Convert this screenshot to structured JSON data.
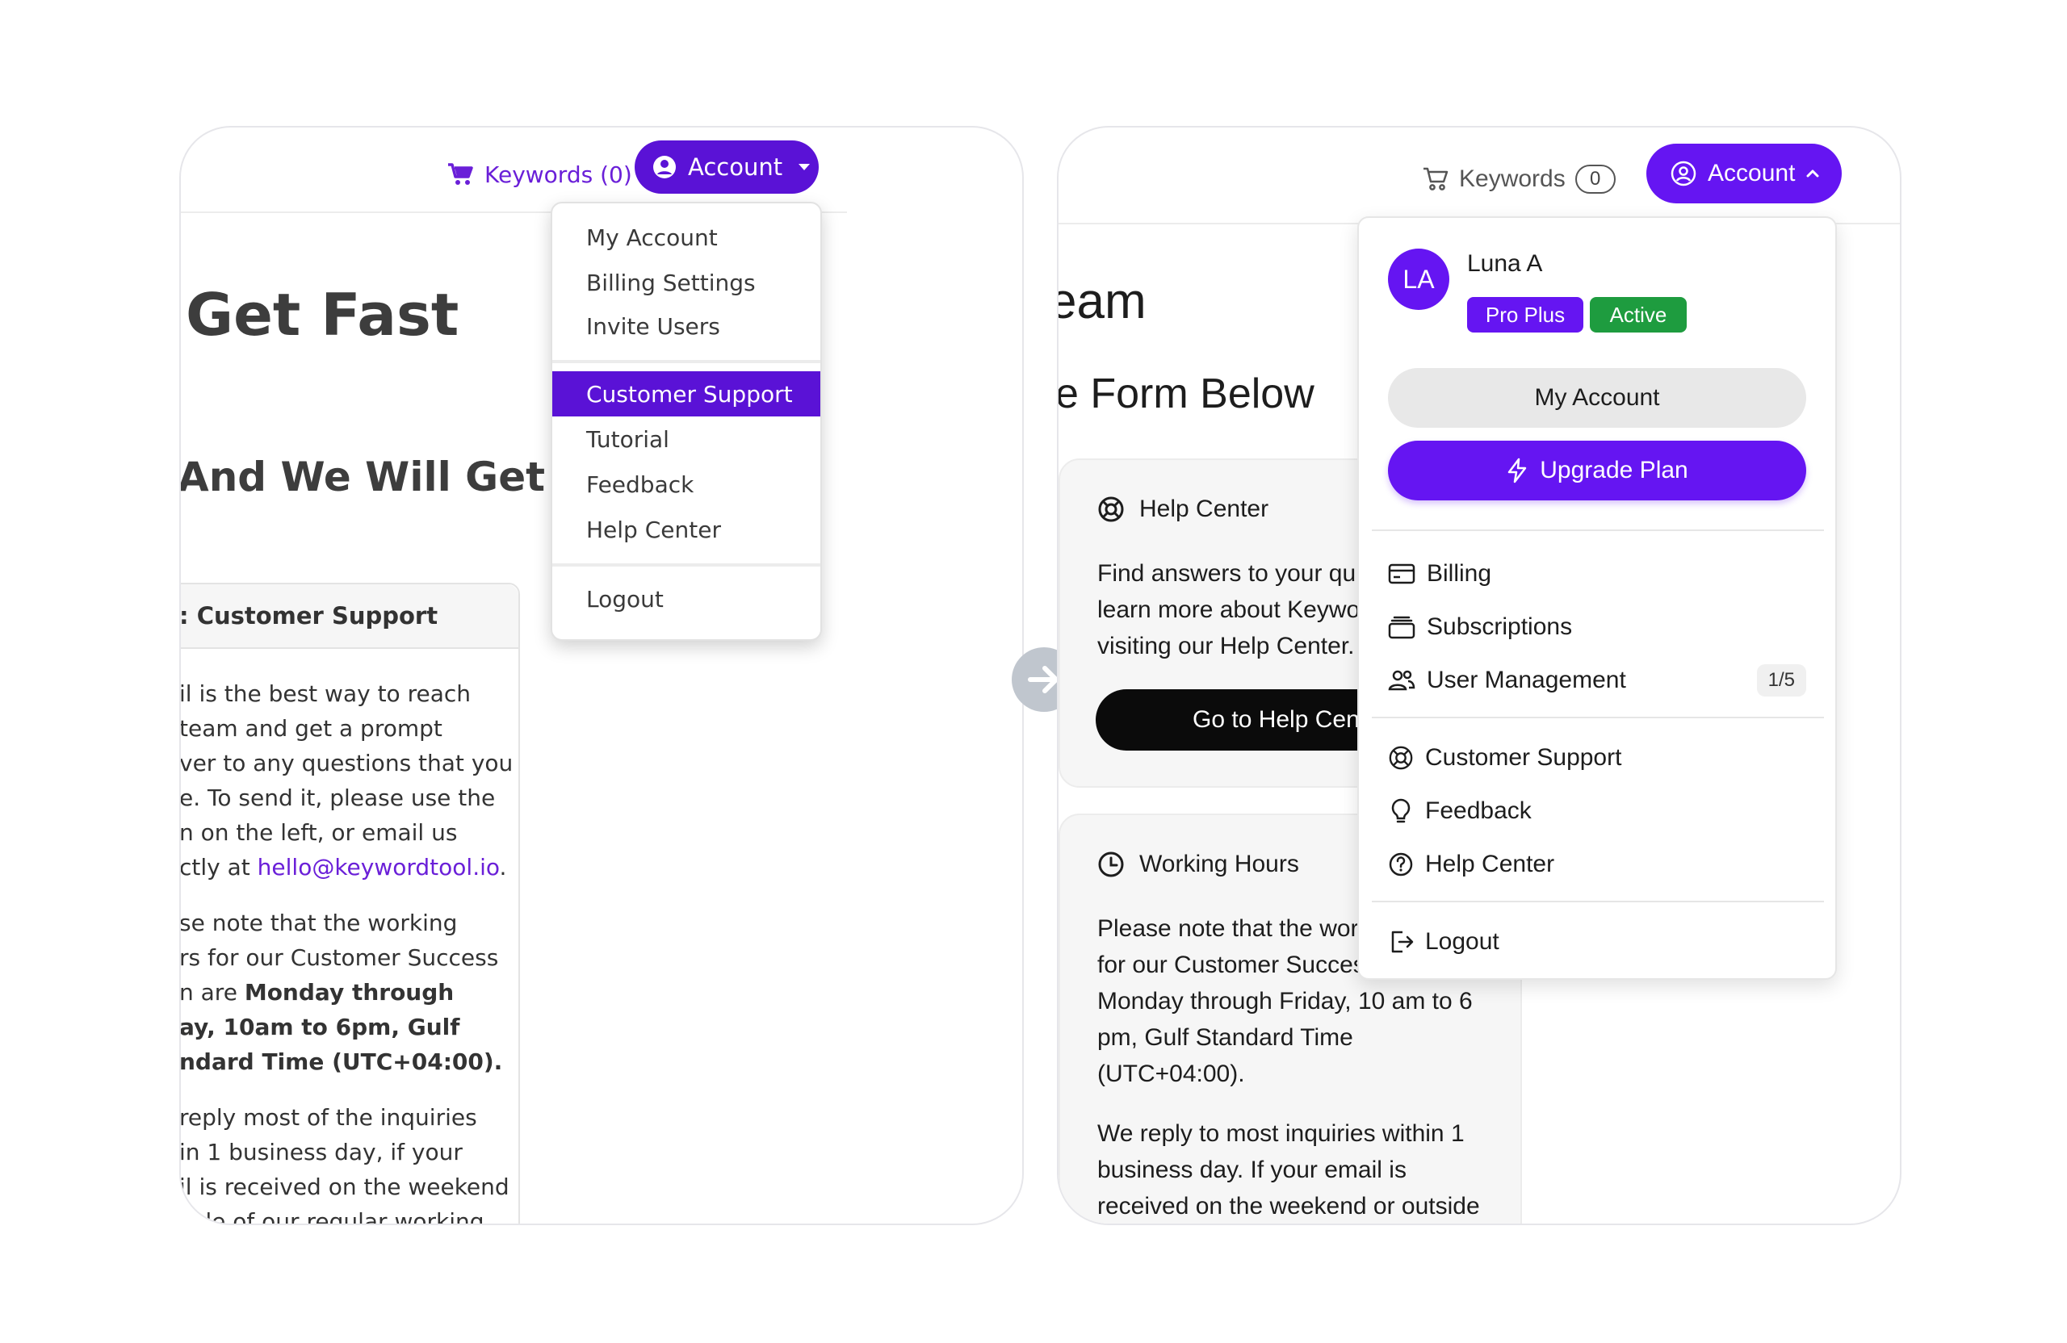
{
  "left": {
    "nav": {
      "keywords_label": "Keywords (0)",
      "account_label": "Account"
    },
    "heading_1": "Get Fast",
    "heading_2": "And We Will Get",
    "card": {
      "title": ": Customer Support",
      "lines_1": [
        "il is the best way to reach",
        "team and get a prompt",
        "ver to any questions that you",
        "e. To send it, please use the",
        "n on the left, or email us"
      ],
      "line_email_prefix": "ctly at ",
      "email": "hello@keywordtool.io",
      "line_email_suffix": ".",
      "lines_2_plain": [
        "se note that the working",
        "rs for our Customer Success"
      ],
      "line_2_mixed_prefix": "n are ",
      "lines_2_bold": [
        "Monday through",
        "ay, 10am to 6pm, Gulf",
        "ndard Time (UTC+04:00)."
      ],
      "lines_3": [
        "reply most of the inquiries",
        "in 1 business day, if your",
        "il is received on the weekend",
        "side of our regular working"
      ]
    },
    "menu": {
      "group_1": [
        "My Account",
        "Billing Settings",
        "Invite Users"
      ],
      "group_2": [
        "Customer Support",
        "Tutorial",
        "Feedback",
        "Help Center"
      ],
      "group_3": [
        "Logout"
      ]
    },
    "colors": {
      "accent": "#5a12d6"
    }
  },
  "right": {
    "nav": {
      "keywords_label": "Keywords",
      "keywords_count": "0",
      "account_label": "Account"
    },
    "heading_1": "eam",
    "heading_2": "e Form Below",
    "help_card": {
      "title": "Help Center",
      "lines": [
        "Find answers to your qu",
        "learn more about Keywo",
        "visiting our Help Center."
      ],
      "button_label": "Go to Help Cen"
    },
    "hours_card": {
      "title": "Working Hours",
      "lines_1": [
        "Please note that the wor",
        "for our Customer Succes",
        "Monday through Friday, 10 am to 6",
        "pm, Gulf Standard Time",
        "(UTC+04:00)."
      ],
      "lines_2": [
        "We reply to most inquiries within 1",
        "business day. If your email is",
        "received on the weekend or outside"
      ]
    },
    "menu": {
      "avatar_initials": "LA",
      "user_name": "Luna A",
      "plan_tag": "Pro Plus",
      "status_tag": "Active",
      "my_account_label": "My Account",
      "upgrade_label": "Upgrade Plan",
      "billing_label": "Billing",
      "subscriptions_label": "Subscriptions",
      "user_management_label": "User Management",
      "user_management_count": "1/5",
      "customer_support_label": "Customer Support",
      "feedback_label": "Feedback",
      "help_center_label": "Help Center",
      "logout_label": "Logout"
    },
    "colors": {
      "accent": "#6515f2",
      "active_green": "#1e9c3f"
    }
  }
}
